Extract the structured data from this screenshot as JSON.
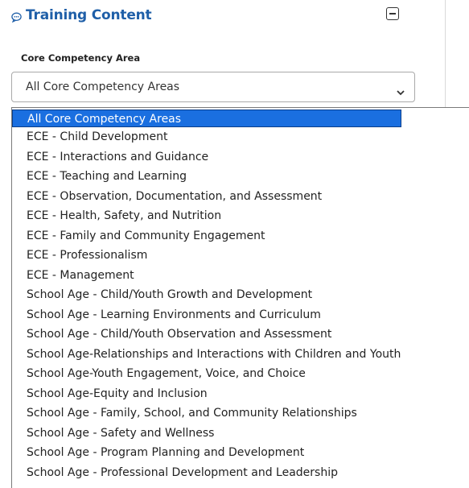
{
  "section": {
    "title": "Training Content",
    "title_icon": "chat-bubble-icon",
    "collapse_icon": "collapse-minus-icon"
  },
  "field": {
    "label": "Core Competency Area",
    "selected_value": "All Core Competency Areas",
    "chevron_icon": "chevron-down-icon"
  },
  "dropdown": {
    "options": [
      "All Core Competency Areas",
      "ECE - Child Development",
      "ECE - Interactions and Guidance",
      "ECE - Teaching and Learning",
      "ECE - Observation, Documentation, and Assessment",
      "ECE - Health, Safety, and Nutrition",
      "ECE - Family and Community Engagement",
      "ECE - Professionalism",
      "ECE - Management",
      "School Age - Child/Youth Growth and Development",
      "School Age - Learning Environments and Curriculum",
      "School Age - Child/Youth Observation and Assessment",
      "School Age-Relationships and Interactions with Children and Youth",
      "School Age-Youth Engagement, Voice, and Choice",
      "School Age-Equity and Inclusion",
      "School Age - Family, School, and Community Relationships",
      "School Age - Safety and Wellness",
      "School Age - Program Planning and Development",
      "School Age - Professional Development and Leadership"
    ]
  },
  "colors": {
    "accent": "#1f5fa8",
    "selected_bg": "#1a6fe0",
    "selected_text": "#ffffff"
  }
}
